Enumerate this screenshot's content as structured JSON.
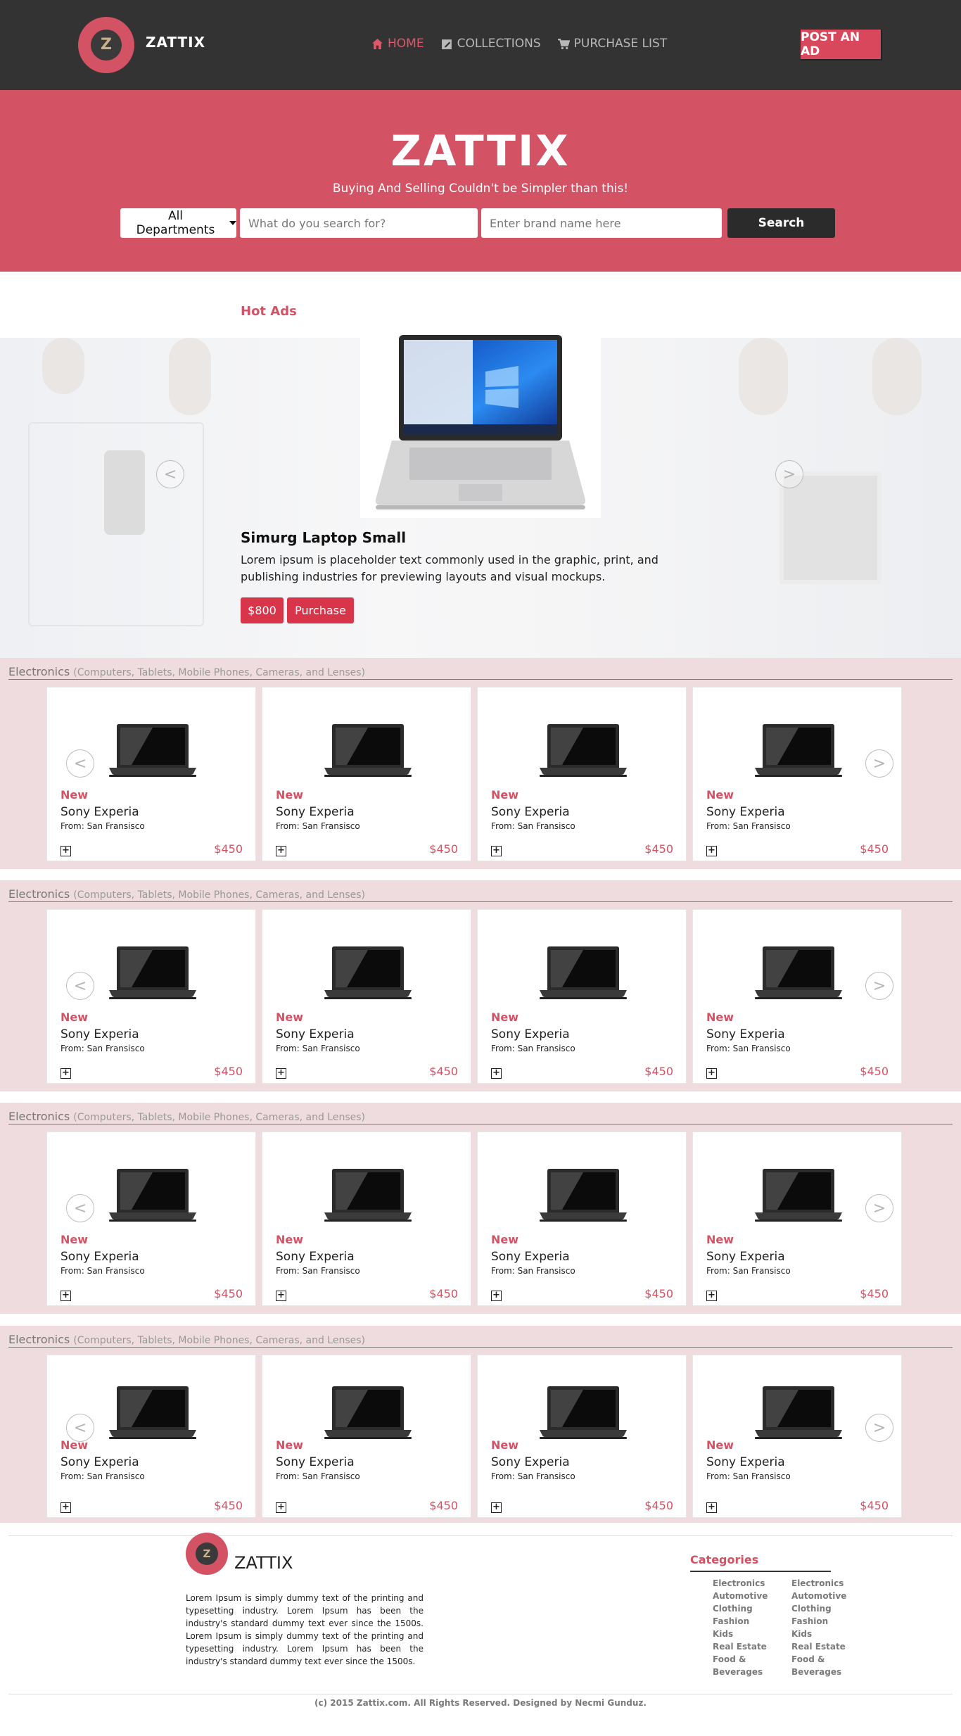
{
  "nav": {
    "brand": "ZATTIX",
    "logo_letter": "Z",
    "links": [
      {
        "label": "HOME",
        "icon": "home-icon",
        "active": true
      },
      {
        "label": "COLLECTIONS",
        "icon": "edit-icon",
        "active": false
      },
      {
        "label": "PURCHASE LIST",
        "icon": "cart-icon",
        "active": false
      }
    ],
    "post_button": "POST AN AD"
  },
  "hero": {
    "title": "ZATTIX",
    "subtitle": "Buying And Selling Couldn't be Simpler than this!",
    "department": "All Departments",
    "search_placeholder": "What do you search for?",
    "brand_placeholder": "Enter brand name here",
    "search_button": "Search"
  },
  "hot": {
    "title": "Hot Ads",
    "name": "Simurg Laptop Small",
    "description": "Lorem ipsum is placeholder text commonly used in the graphic, print, and publishing industries for previewing layouts and visual mockups.",
    "price": "$800",
    "purchase": "Purchase",
    "prev": "<",
    "next": ">"
  },
  "sections": [
    {
      "title": "Electronics",
      "subtitle": "(Computers, Tablets, Mobile Phones, Cameras, and Lenses)"
    },
    {
      "title": "Electronics",
      "subtitle": "(Computers, Tablets, Mobile Phones, Cameras, and Lenses)"
    },
    {
      "title": "Electronics",
      "subtitle": "(Computers, Tablets, Mobile Phones, Cameras, and Lenses)"
    },
    {
      "title": "Electronics",
      "subtitle": "(Computers, Tablets, Mobile Phones, Cameras, and Lenses)"
    }
  ],
  "product": {
    "condition": "New",
    "name": "Sony Experia",
    "location": "From: San Fransisco",
    "price": "$450",
    "add": "+"
  },
  "footer": {
    "brand": "ZATTIX",
    "logo_letter": "Z",
    "about": "Lorem Ipsum is simply dummy text of the printing and typesetting industry. Lorem Ipsum has been the industry's standard dummy text ever since the 1500s. Lorem Ipsum is simply dummy text of the printing and typesetting industry. Lorem Ipsum has been the industry's standard dummy text ever since the 1500s.",
    "categories_title": "Categories",
    "categories": [
      "Electronics",
      "Automotive",
      "Clothing",
      "Fashion",
      "Kids",
      "Real Estate",
      "Food & Beverages"
    ],
    "copyright": "(c) 2015 Zattix.com. All Rights Reserved. Designed by Necmi Gunduz."
  },
  "colors": {
    "accent": "#d35264",
    "dark": "#333333",
    "section_bg": "#efdcde"
  }
}
